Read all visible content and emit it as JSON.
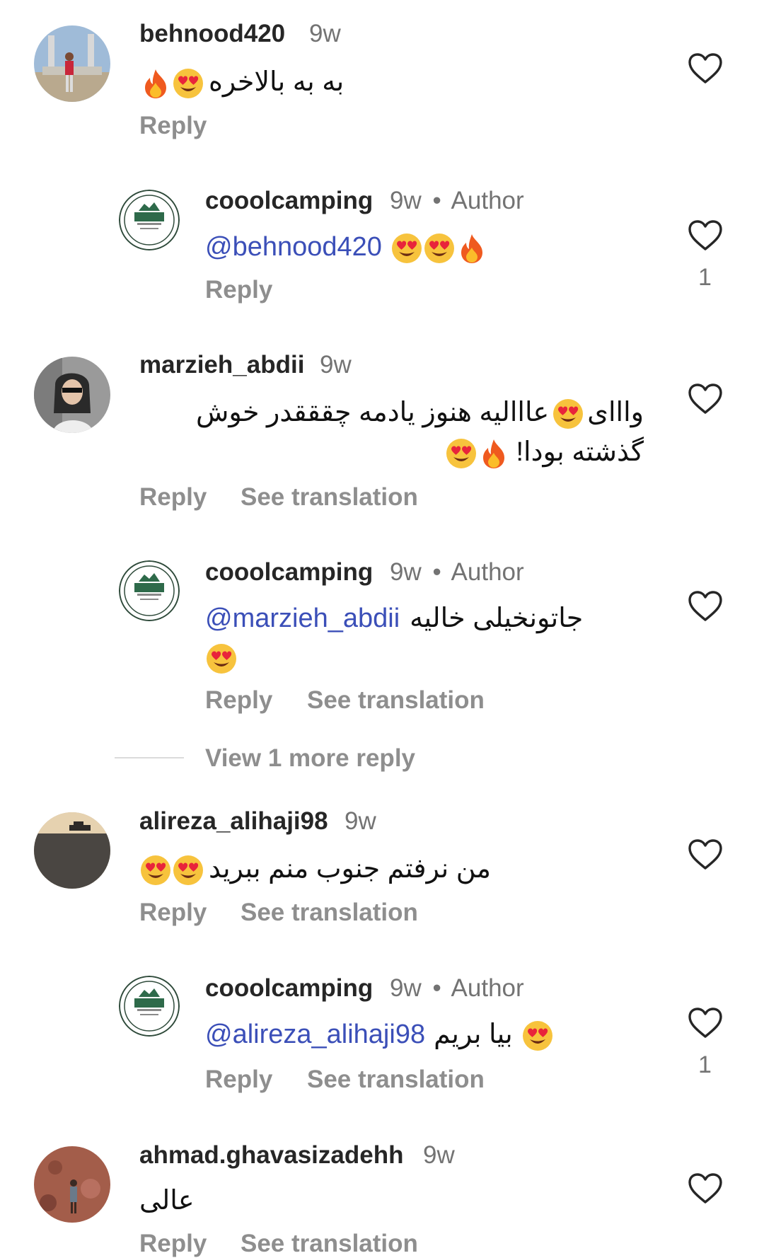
{
  "comments": [
    {
      "username": "behnood420",
      "time": "9w",
      "text": "به به بالاخره",
      "emojis": [
        "fire-emoji",
        "heart-eyes-emoji"
      ],
      "reply_label": "Reply"
    },
    {
      "username": "cooolcamping",
      "time": "9w",
      "author_sep": "•",
      "author_label": "Author",
      "mention": "@behnood420",
      "emojis": [
        "heart-eyes-emoji",
        "heart-eyes-emoji",
        "fire-emoji"
      ],
      "reply_label": "Reply",
      "like_count": "1"
    },
    {
      "username": "marzieh_abdii",
      "time": "9w",
      "text_line1": "وااای",
      "text_line1b": "عااالیه هنوز یادمه چقققدر خوش",
      "text_line2": "گذشته بودا!",
      "emojis": [
        "heart-eyes-emoji",
        "fire-emoji",
        "heart-eyes-emoji"
      ],
      "reply_label": "Reply",
      "translation_label": "See translation"
    },
    {
      "username": "cooolcamping",
      "time": "9w",
      "author_sep": "•",
      "author_label": "Author",
      "mention": "@marzieh_abdii",
      "text": "جاتونخیلی خالیه",
      "emojis": [
        "heart-eyes-emoji"
      ],
      "reply_label": "Reply",
      "translation_label": "See translation",
      "view_more_label": "View 1 more reply"
    },
    {
      "username": "alireza_alihaji98",
      "time": "9w",
      "text": "من نرفتم جنوب منم ببرید",
      "emojis": [
        "heart-eyes-emoji",
        "heart-eyes-emoji"
      ],
      "reply_label": "Reply",
      "translation_label": "See translation"
    },
    {
      "username": "cooolcamping",
      "time": "9w",
      "author_sep": "•",
      "author_label": "Author",
      "mention": "@alireza_alihaji98",
      "text": "بیا بریم",
      "emojis": [
        "heart-eyes-emoji"
      ],
      "reply_label": "Reply",
      "translation_label": "See translation",
      "like_count": "1"
    },
    {
      "username": "ahmad.ghavasizadehh",
      "time": "9w",
      "text": "عالی",
      "reply_label": "Reply",
      "translation_label": "See translation"
    }
  ],
  "colors": {
    "mention": "#3b4fb8",
    "secondary_text": "#737373",
    "action_text": "#8e8e8e"
  }
}
